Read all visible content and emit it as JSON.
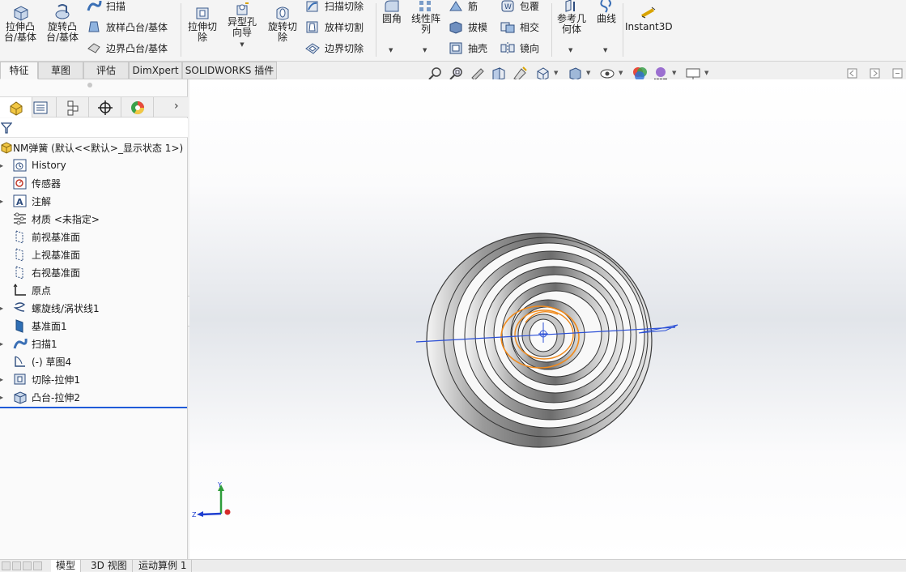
{
  "ribbon": {
    "extrude_boss": "拉伸凸\n台/基体",
    "revolve_boss": "旋转凸\n台/基体",
    "sweep": "扫描",
    "loft_boss": "放样凸台/基体",
    "boundary_boss": "边界凸台/基体",
    "extrude_cut": "拉伸切\n除",
    "hole_wizard": "异型孔\n向导",
    "revolve_cut": "旋转切\n除",
    "swept_cut": "扫描切除",
    "lofted_cut": "放样切割",
    "boundary_cut": "边界切除",
    "fillet": "圆角",
    "linear_pattern": "线性阵\n列",
    "rib": "筋",
    "draft": "拔模",
    "shell": "抽壳",
    "wrap": "包覆",
    "intersect": "相交",
    "mirror": "镜向",
    "reference_geometry": "参考几\n何体",
    "curves": "曲线",
    "instant3d": "Instant3D"
  },
  "tabs": [
    "特征",
    "草图",
    "评估",
    "DimXpert",
    "SOLIDWORKS 插件"
  ],
  "tree": {
    "root": "NM弹簧  (默认<<默认>_显示状态 1>)",
    "items": [
      {
        "label": "History",
        "icon": "history-icon",
        "expandable": true
      },
      {
        "label": "传感器",
        "icon": "sensor-icon",
        "expandable": false
      },
      {
        "label": "注解",
        "icon": "annotation-icon",
        "expandable": true
      },
      {
        "label": "材质 <未指定>",
        "icon": "material-icon",
        "expandable": false
      },
      {
        "label": "前视基准面",
        "icon": "plane-icon",
        "expandable": false
      },
      {
        "label": "上视基准面",
        "icon": "plane-icon",
        "expandable": false
      },
      {
        "label": "右视基准面",
        "icon": "plane-icon",
        "expandable": false
      },
      {
        "label": "原点",
        "icon": "origin-icon",
        "expandable": false
      },
      {
        "label": "螺旋线/涡状线1",
        "icon": "helix-icon",
        "expandable": true
      },
      {
        "label": "基准面1",
        "icon": "plane-feature-icon",
        "expandable": false
      },
      {
        "label": "扫描1",
        "icon": "sweep-feature-icon",
        "expandable": true
      },
      {
        "label": "(-) 草图4",
        "icon": "sketch-icon",
        "expandable": false
      },
      {
        "label": "切除-拉伸1",
        "icon": "cut-extrude-icon",
        "expandable": true
      },
      {
        "label": "凸台-拉伸2",
        "icon": "boss-extrude-icon",
        "expandable": true
      }
    ]
  },
  "triad": {
    "y": "Y",
    "z": "Z"
  },
  "bottom_tabs": [
    "模型",
    "3D 视图",
    "运动算例 1"
  ],
  "colors": {
    "accent_blue": "#1f5bd8",
    "sketch_orange": "#f08a1c",
    "selection_line": "#2b4fd6"
  }
}
